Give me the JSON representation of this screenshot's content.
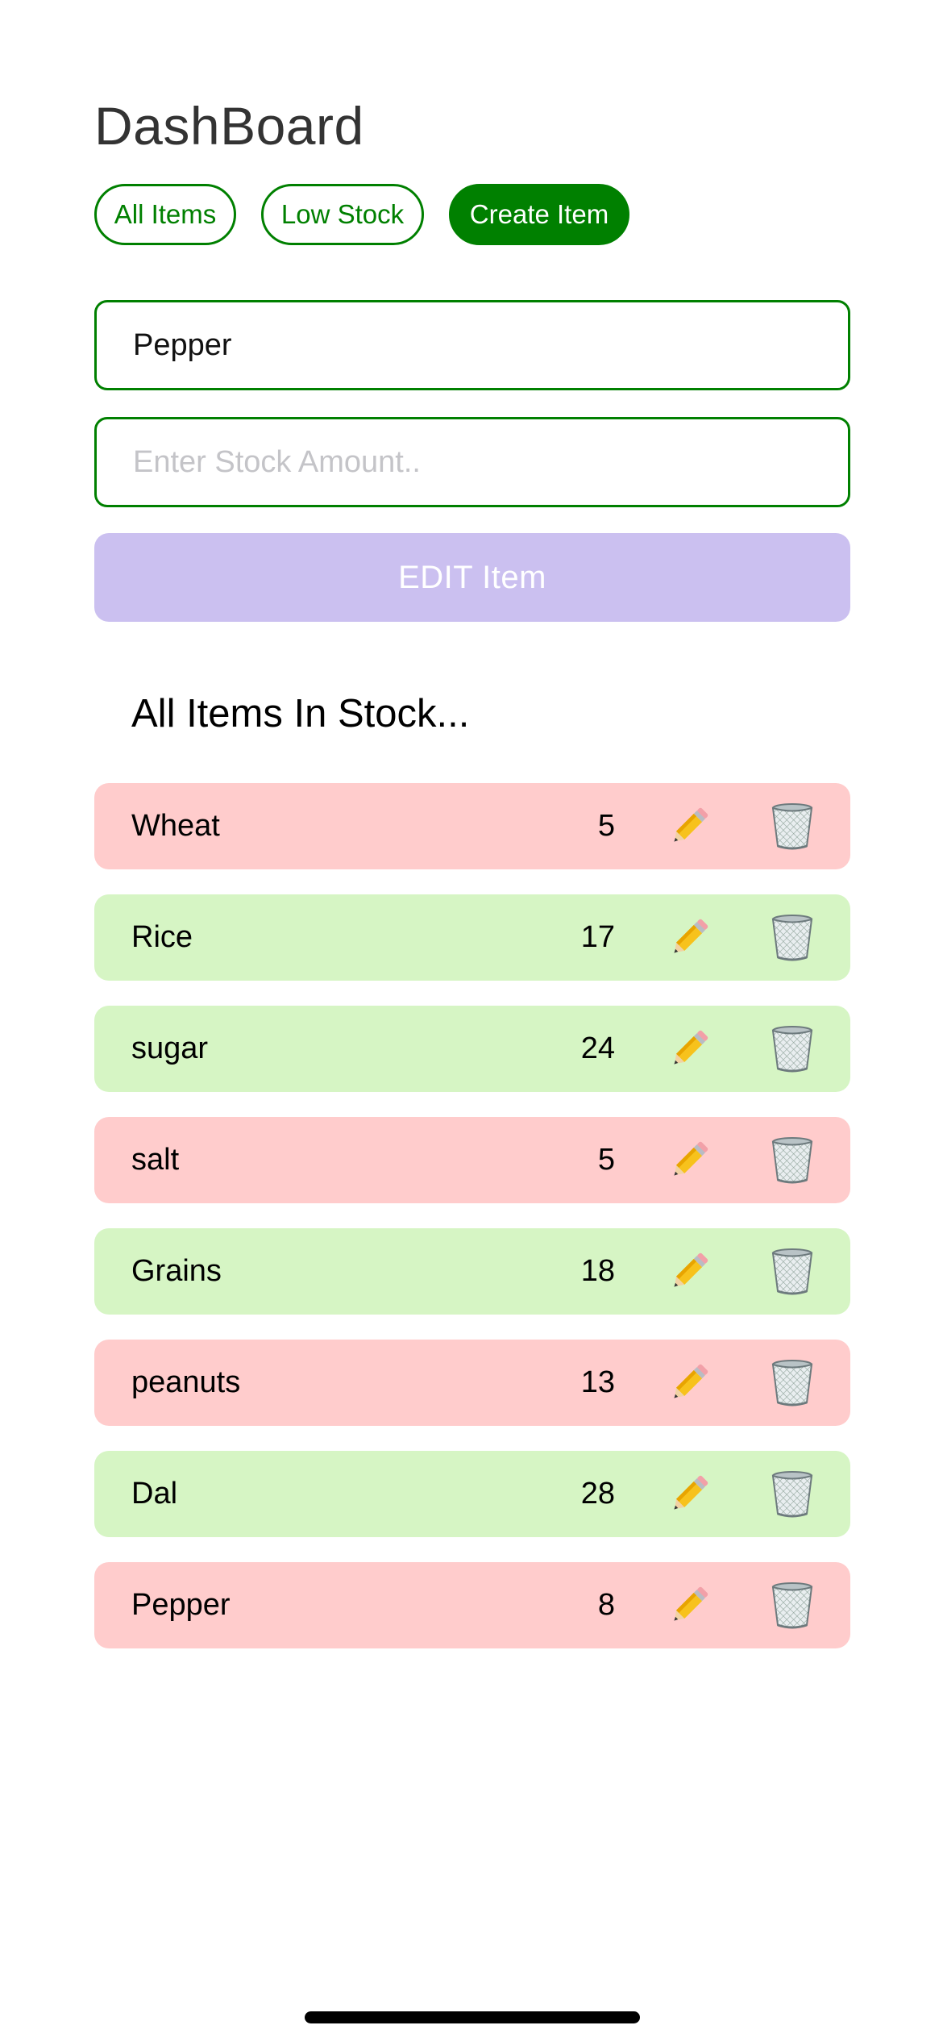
{
  "header": {
    "title": "DashBoard"
  },
  "tabs": [
    {
      "label": "All Items",
      "active": false
    },
    {
      "label": "Low Stock",
      "active": false
    },
    {
      "label": "Create Item",
      "active": true
    }
  ],
  "form": {
    "name_value": "Pepper",
    "stock_placeholder": "Enter Stock Amount..",
    "submit_label": "EDIT Item"
  },
  "section": {
    "heading": "All Items In Stock..."
  },
  "items": [
    {
      "name": "Wheat",
      "qty": "5",
      "status": "low"
    },
    {
      "name": "Rice",
      "qty": "17",
      "status": "ok"
    },
    {
      "name": "sugar",
      "qty": "24",
      "status": "ok"
    },
    {
      "name": "salt",
      "qty": "5",
      "status": "low"
    },
    {
      "name": "Grains",
      "qty": "18",
      "status": "ok"
    },
    {
      "name": "peanuts",
      "qty": "13",
      "status": "low"
    },
    {
      "name": "Dal",
      "qty": "28",
      "status": "ok"
    },
    {
      "name": "Pepper",
      "qty": "8",
      "status": "low"
    }
  ],
  "icons": {
    "edit": "pencil-icon",
    "delete": "trash-can-icon"
  },
  "colors": {
    "accent": "#008000",
    "low_stock_row": "#ffcccc",
    "ok_stock_row": "#d6f5c4",
    "edit_button": "#cbc0f0"
  }
}
